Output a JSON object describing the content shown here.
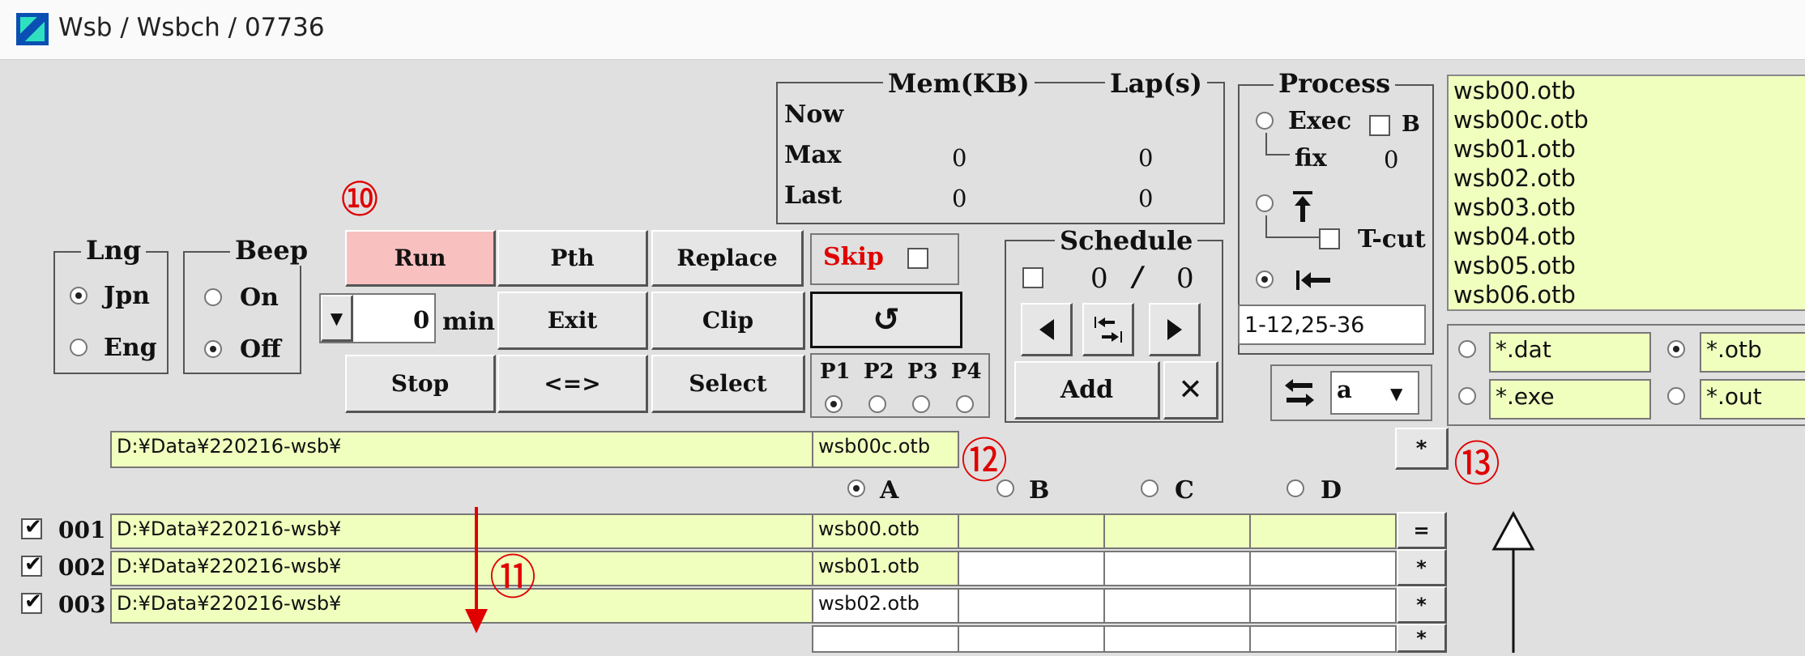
{
  "window": {
    "title": "Wsb / Wsbch / 07736"
  },
  "mem": {
    "title_mem": "Mem(KB)",
    "title_lap": "Lap(s)",
    "rows": [
      {
        "label": "Now",
        "mem": "",
        "lap": ""
      },
      {
        "label": "Max",
        "mem": "0",
        "lap": "0"
      },
      {
        "label": "Last",
        "mem": "0",
        "lap": "0"
      }
    ]
  },
  "process": {
    "title": "Process",
    "exec": "Exec",
    "b": "B",
    "fix": "fix",
    "fix_value": "0",
    "top_icon": "up-bar-arrow",
    "tcut": "T-cut",
    "left_icon": "left-bar-arrow",
    "range": "1-12,25-36"
  },
  "files": {
    "items": [
      "wsb00.otb",
      "wsb00c.otb",
      "wsb01.otb",
      "wsb02.otb",
      "wsb03.otb",
      "wsb04.otb",
      "wsb05.otb",
      "wsb06.otb"
    ]
  },
  "lng": {
    "title": "Lng",
    "jpn": "Jpn",
    "eng": "Eng"
  },
  "beep": {
    "title": "Beep",
    "on": "On",
    "off": "Off"
  },
  "buttons": {
    "run": "Run",
    "pth": "Pth",
    "replace": "Replace",
    "skip": "Skip",
    "min_value": "0",
    "min_label": "min",
    "exit": "Exit",
    "clip": "Clip",
    "refresh": "↺",
    "stop": "Stop",
    "swap": "<=>",
    "select": "Select"
  },
  "p": {
    "p1": "P1",
    "p2": "P2",
    "p3": "P3",
    "p4": "P4"
  },
  "schedule": {
    "title": "Schedule",
    "count_a": "0",
    "slash": "/",
    "count_b": "0",
    "add": "Add",
    "close": "✕"
  },
  "swapsel": {
    "value": "a"
  },
  "filters": {
    "dat": "*.dat",
    "otb": "*.otb",
    "exe": "*.exe",
    "out": "*.out"
  },
  "path": {
    "main": "D:¥Data¥220216-wsb¥",
    "file": "wsb00c.otb",
    "star": "*"
  },
  "abcd": {
    "a": "A",
    "b": "B",
    "c": "C",
    "d": "D"
  },
  "rows": [
    {
      "num": "001",
      "path": "D:¥Data¥220216-wsb¥",
      "file": "wsb00.otb",
      "btn": "="
    },
    {
      "num": "002",
      "path": "D:¥Data¥220216-wsb¥",
      "file": "wsb01.otb",
      "btn": "*"
    },
    {
      "num": "003",
      "path": "D:¥Data¥220216-wsb¥",
      "file": "wsb02.otb",
      "btn": "*"
    },
    {
      "btn": "*"
    }
  ],
  "annotations": {
    "n10": "⑩",
    "n11": "⑪",
    "n12": "⑫",
    "n13": "⑬"
  },
  "colors": {
    "field_bg": "#f0ffbe",
    "run_bg": "#f9c0c0",
    "annotation": "#e00000",
    "skip": "#e00000"
  }
}
